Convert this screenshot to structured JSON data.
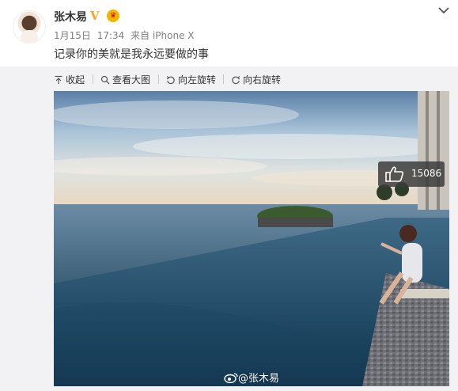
{
  "post": {
    "username": "张木易",
    "verified_badge": "V",
    "member_badge_icon": "crown-icon",
    "date": "1月15日",
    "time": "17:34",
    "source": "来自 iPhone X",
    "text": "记录你的美就是我永远要做的事"
  },
  "toolbar": {
    "collapse_label": "收起",
    "view_large_label": "查看大图",
    "rotate_left_label": "向左旋转",
    "rotate_right_label": "向右旋转"
  },
  "photo": {
    "likes": "15086",
    "watermark": "@张木易",
    "watermark_icon": "weibo-logo-icon"
  },
  "colors": {
    "accent_verified": "#f5a623",
    "meta_text": "#808080",
    "panel_bg": "#f2f2f5"
  }
}
